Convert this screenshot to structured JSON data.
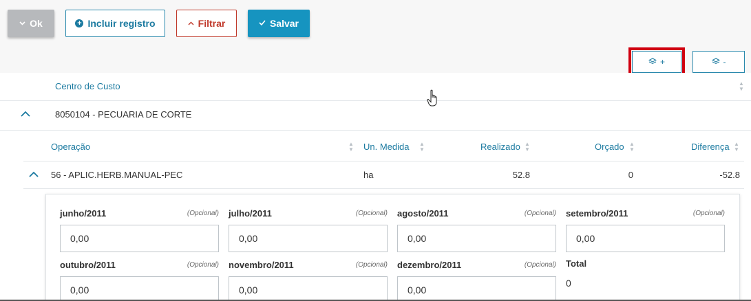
{
  "toolbar": {
    "ok_label": "Ok",
    "incluir_label": "Incluir registro",
    "filtrar_label": "Filtrar",
    "salvar_label": "Salvar"
  },
  "expand_controls": {
    "expand_label": "+",
    "collapse_label": "-"
  },
  "main_table": {
    "column_header": "Centro de Custo",
    "group_row": "8050104 - PECUARIA DE CORTE"
  },
  "sub_table": {
    "headers": {
      "operacao": "Operação",
      "un_medida": "Un. Medida",
      "realizado": "Realizado",
      "orcado": "Orçado",
      "diferenca": "Diferença"
    },
    "row": {
      "operacao": "56 - APLIC.HERB.MANUAL-PEC",
      "un_medida": "ha",
      "realizado": "52.8",
      "orcado": "0",
      "diferenca": "-52.8"
    }
  },
  "monthly_form": {
    "optional_text": "(Opcional)",
    "fields": [
      {
        "label": "junho/2011",
        "value": "0,00"
      },
      {
        "label": "julho/2011",
        "value": "0,00"
      },
      {
        "label": "agosto/2011",
        "value": "0,00"
      },
      {
        "label": "setembro/2011",
        "value": "0,00"
      },
      {
        "label": "outubro/2011",
        "value": "0,00"
      },
      {
        "label": "novembro/2011",
        "value": "0,00"
      },
      {
        "label": "dezembro/2011",
        "value": "0,00"
      }
    ],
    "total_label": "Total",
    "total_value": "0"
  },
  "colors": {
    "primary": "#1694c0",
    "link": "#1b7aa0",
    "danger": "#c0392b",
    "disabled": "#b7b9bc",
    "highlight": "#d00010"
  },
  "icons": {
    "ok": "chevron-down-icon",
    "incluir": "plus-circle-icon",
    "filtrar": "chevron-up-icon",
    "salvar": "check-icon",
    "layers": "layers-icon"
  }
}
